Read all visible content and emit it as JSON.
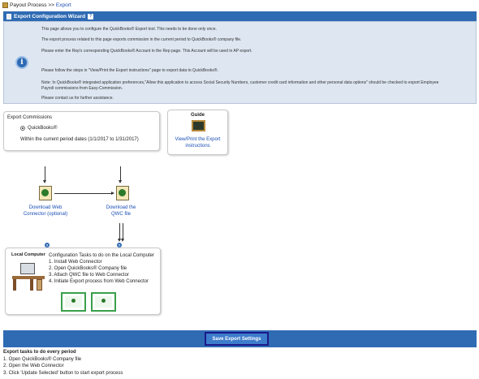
{
  "breadcrumb": {
    "parent": "Payout Process >>",
    "current": "Export"
  },
  "wizard": {
    "title": "Export Configuration Wizard"
  },
  "info": {
    "lines": [
      "This page allows you to configure the QuickBooks® Export tool. This needs to be done only once.",
      "The export process related to this page exports commission in the current period to QuickBooks® company file.",
      "Please enter the Rep's corresponding QuickBooks® Account in the Rep page. This Account will be used in AP export.",
      "Please follow the steps in \"View/Print the Export instructions\" page to export data to QuickBooks®.",
      "Note: In QuickBooks® integrated application preferences,\"Allow this application to access Social Security Numbers, customer credit card information and other personal data options\" should be checked to export Employee",
      "Payroll commissions from Easy-Commission.",
      "Please contact us for further assistance."
    ]
  },
  "export_commissions": {
    "title": "Export Commissions",
    "option": "QuickBooks®",
    "period": "Within the current period dates (1/1/2017 to 1/31/2017)"
  },
  "guide": {
    "title": "Guide",
    "link": "View/Print the Export instructions"
  },
  "downloads": {
    "web_connector": "Download Web Connector (optional)",
    "qwc_file": "Download the QWC file"
  },
  "local_computer": {
    "title": "Local Computer",
    "heading": "Configuration Tasks to do on the Local Computer",
    "tasks": [
      "1. Install Web Connector",
      "2. Open QuickBooks® Company file",
      "3. Attach QWC file to Web Connector",
      "4. Initiate Export process from Web Connector"
    ]
  },
  "save_button": "Save Export Settings",
  "period_tasks": {
    "title": "Export tasks to do every period",
    "items": [
      "1. Open QuickBooks® Company file",
      "2. Open the Web Connector",
      "3. Click 'Update Selected' button to start export process"
    ]
  },
  "colors": {
    "header": "#2f6bb3",
    "info_bg": "#dde6f1",
    "link": "#1a4fb5"
  }
}
